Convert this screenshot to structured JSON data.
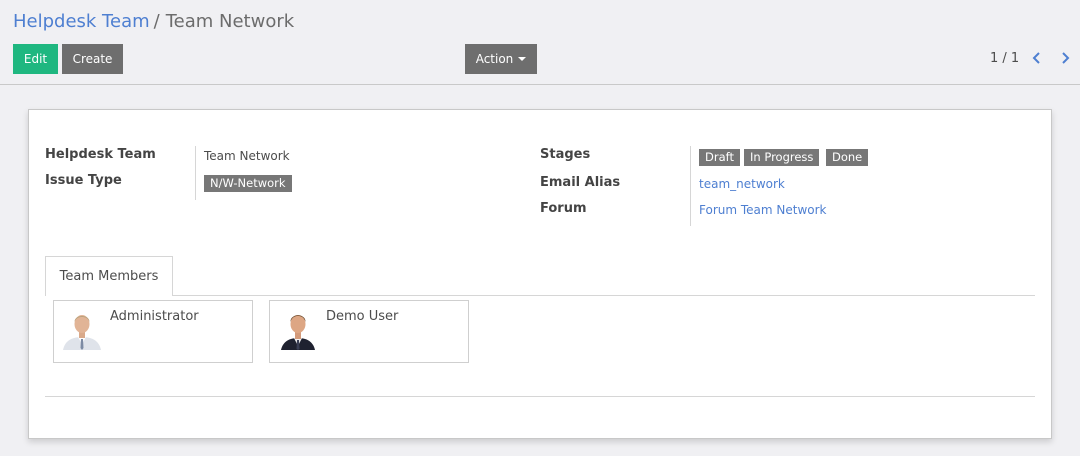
{
  "breadcrumb": {
    "parent": "Helpdesk Team",
    "separator": "/",
    "current": "Team Network"
  },
  "toolbar": {
    "edit_label": "Edit",
    "create_label": "Create",
    "action_label": "Action"
  },
  "pager": {
    "value": "1 / 1"
  },
  "form": {
    "helpdesk_team_label": "Helpdesk Team",
    "helpdesk_team_value": "Team Network",
    "issue_type_label": "Issue Type",
    "issue_type_tag": "N/W-Network",
    "stages_label": "Stages",
    "stages": [
      "Draft",
      "In Progress",
      "Done"
    ],
    "email_alias_label": "Email Alias",
    "email_alias_value": "team_network",
    "forum_label": "Forum",
    "forum_value": "Forum Team Network"
  },
  "tabs": {
    "team_members": "Team Members"
  },
  "members": [
    {
      "name": "Administrator"
    },
    {
      "name": "Demo User"
    }
  ],
  "colors": {
    "edit_button": "#1fb780",
    "secondary_button": "#6e6e6e",
    "link": "#4e7fd1",
    "tag": "#777777"
  }
}
